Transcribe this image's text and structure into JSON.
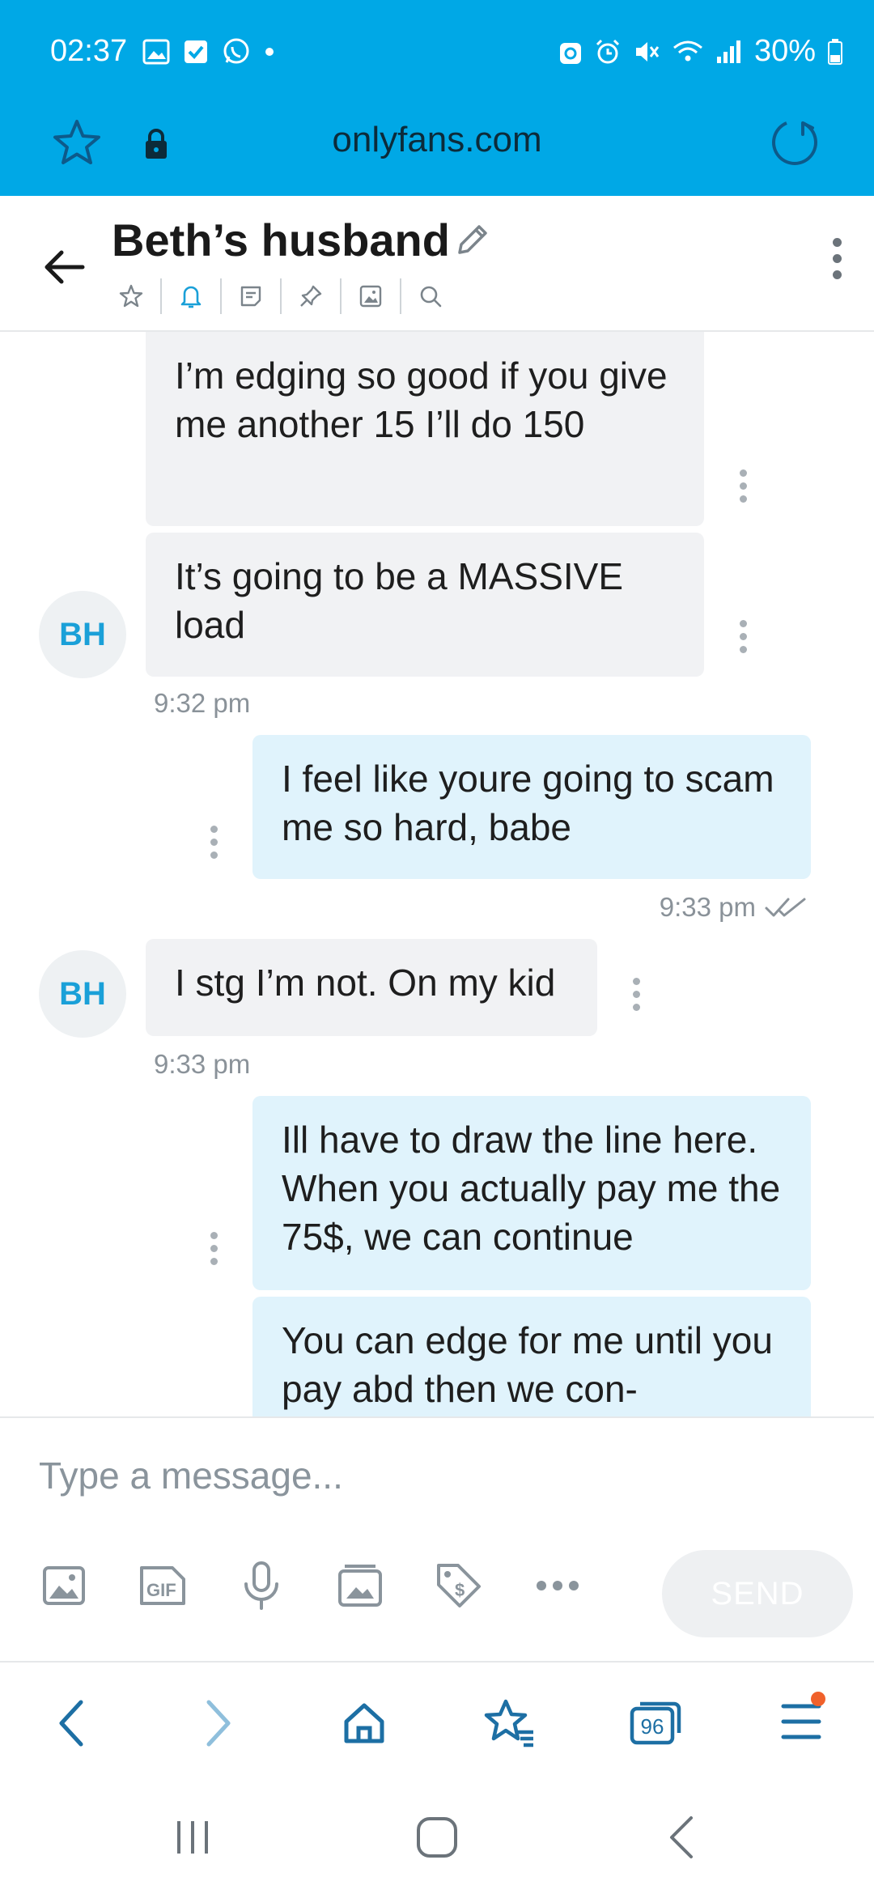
{
  "status_bar": {
    "time": "02:37",
    "battery": "30%"
  },
  "browser": {
    "url": "onlyfans.com",
    "tab_count": "96"
  },
  "chat": {
    "contact_name": "Beth’s husband",
    "avatar_initials": "BH",
    "messages": [
      {
        "side": "in",
        "text": "I’m edging so good if you give me another 15 I’ll do 150"
      },
      {
        "side": "in",
        "text": "It’s going to be a MASSIVE load"
      },
      {
        "side": "in",
        "time": "9:32 pm"
      },
      {
        "side": "out",
        "text": "I feel like youre going to scam me so hard, babe"
      },
      {
        "side": "out",
        "time": "9:33 pm"
      },
      {
        "side": "in",
        "text": "I stg I’m not. On my kid"
      },
      {
        "side": "in",
        "time": "9:33 pm"
      },
      {
        "side": "out",
        "text": "Ill have to draw the line here. When you actually pay me the 75$, we can continue"
      },
      {
        "side": "out",
        "text": "You can edge for me until you pay abd then we con-"
      }
    ]
  },
  "composer": {
    "placeholder": "Type a message...",
    "send_label": "SEND"
  },
  "colors": {
    "brand": "#00a8e6",
    "incoming_bubble": "#f1f2f4",
    "outgoing_bubble": "#e0f3fc",
    "accent_text": "#1aa0d8"
  }
}
